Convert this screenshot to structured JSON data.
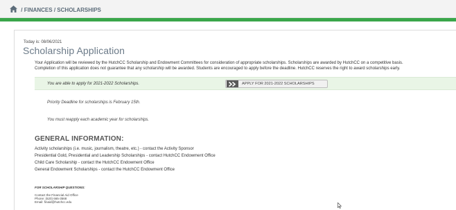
{
  "breadcrumb": {
    "separator": "/",
    "items": [
      "FINANCES",
      "SCHOLARSHIPS"
    ]
  },
  "page": {
    "date_label": "Today is: 08/06/2021",
    "title": "Scholarship Application",
    "intro_line1": "Your Application will be reviewed by the HutchCC Scholarship and Endowment Committees for consideration of appropriate scholarships. Scholarships are awarded by HutchCC on a competitive basis.",
    "intro_line2": "Completion of this application does not guarantee that any scholarship will be awarded. Students are encouraged to apply before the deadline. HutchCC reserves the right to award scholarships early."
  },
  "banner": {
    "message": "You are able to apply for 2021-2022 Scholarships.",
    "apply_button_label": "APPLY FOR 2021-2022 SCHOLARSHIPS",
    "apply_icon": "double-chevron-right-icon"
  },
  "notes": [
    "Priority Deadline for scholarships is February 15th.",
    "You must reapply each academic year for scholarships."
  ],
  "general": {
    "heading": "GENERAL INFORMATION:",
    "items": [
      "Activity scholarships (i.e. music, journalism, theatre, etc.) - contact the Activity Sponsor",
      "Presidential Gold, Presidential and Leadership Scholarships - contact HutchCC Endowment Office",
      "Child Care Scholarship - contact the HutchCC Endowment Office",
      "General Endowment Scholarships - contact the HutchCC Endowment Office"
    ]
  },
  "questions": {
    "heading": "FOR SCHOLARSHIP QUESTIONS:",
    "lines": [
      "Contact the Financial Aid Office",
      "Phone: (620) 665-3568",
      "Email: finaid@hutchcc.edu"
    ]
  },
  "colors": {
    "accent_green": "#3aa64a",
    "banner_bg": "#e9f5e6",
    "title": "#6b7a88"
  }
}
